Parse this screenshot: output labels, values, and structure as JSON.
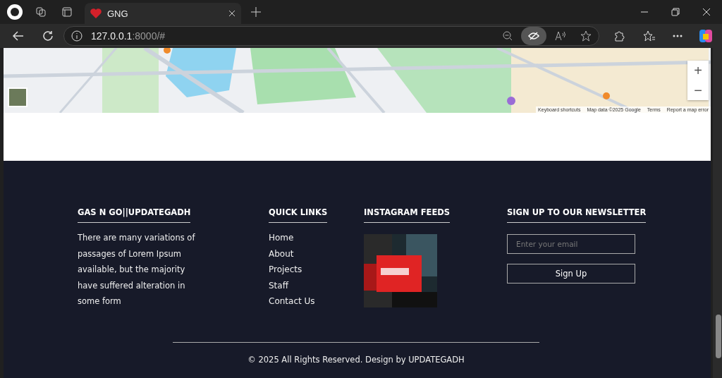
{
  "browser": {
    "tab": {
      "title": "GNG",
      "selected": true
    },
    "url_host": "127.0.0.1",
    "url_rest": ":8000/#"
  },
  "map": {
    "kind": "picture",
    "zoom_in": "+",
    "zoom_out": "−",
    "attribution": [
      "Keyboard shortcuts",
      "Map data ©2025 Google",
      "Terms",
      "Report a map error"
    ]
  },
  "footer": {
    "about": {
      "title": "GAS N GO||UPDATEGADH",
      "text": "There are many variations of passages of Lorem Ipsum available, but the majority have suffered alteration in some form"
    },
    "links": {
      "title": "QUICK LINKS",
      "items": [
        "Home",
        "About",
        "Projects",
        "Staff",
        "Contact Us"
      ]
    },
    "instagram": {
      "title": "INSTAGRAM FEEDS"
    },
    "newsletter": {
      "title": "SIGN UP TO OUR NEWSLETTER",
      "placeholder": "Enter your email",
      "button": "Sign Up"
    },
    "copyright": "© 2025 All Rights Reserved. Design by UPDATEGADH"
  }
}
